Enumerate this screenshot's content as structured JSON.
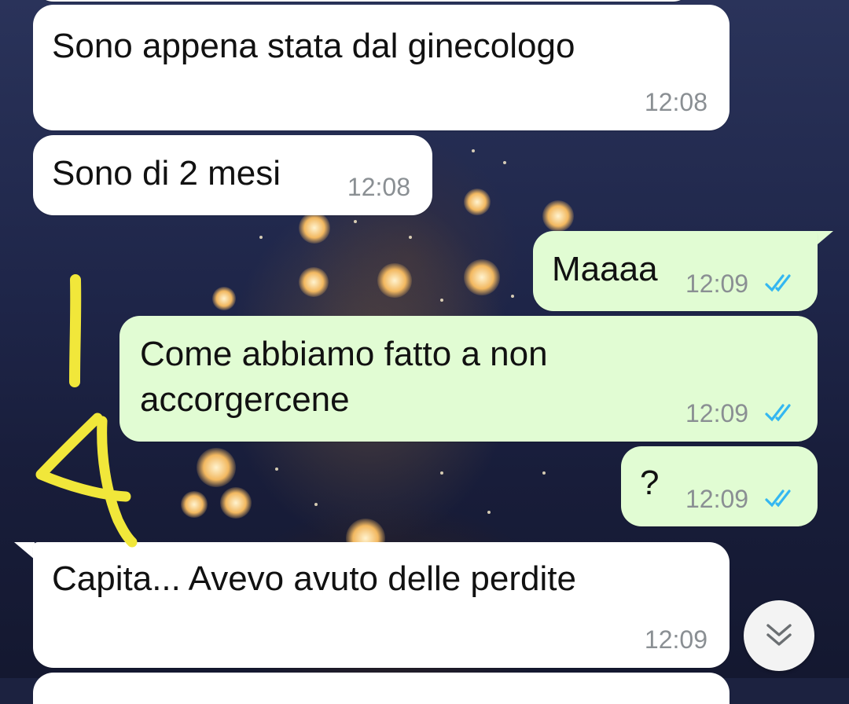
{
  "colors": {
    "incoming_bubble": "#ffffff",
    "outgoing_bubble": "#e1fcd3",
    "timestamp": "#8a8f93",
    "read_ticks": "#34b7f1",
    "annotation": "#f1e73a"
  },
  "messages": [
    {
      "direction": "in",
      "text": "Sono appena stata dal ginecologo",
      "time": "12:08"
    },
    {
      "direction": "in",
      "text": "Sono di 2 mesi",
      "time": "12:08"
    },
    {
      "direction": "out",
      "text": "Maaaa",
      "time": "12:09",
      "status": "read"
    },
    {
      "direction": "out",
      "text": "Come abbiamo fatto a non\naccorgercene",
      "time": "12:09",
      "status": "read"
    },
    {
      "direction": "out",
      "text": "?",
      "time": "12:09",
      "status": "read"
    },
    {
      "direction": "in",
      "text": "Capita... Avevo avuto delle perdite",
      "time": "12:09"
    }
  ],
  "annotation": {
    "text": "14"
  },
  "scroll_button": {
    "icon": "double-chevron-down-icon"
  }
}
